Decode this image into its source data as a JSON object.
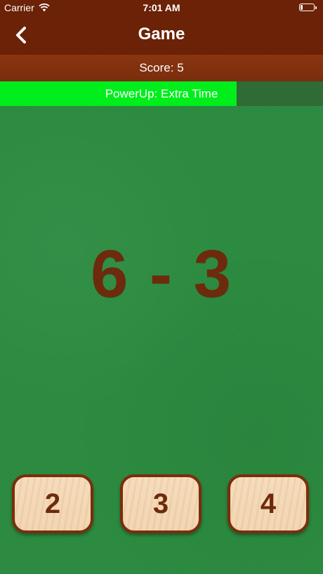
{
  "status": {
    "carrier": "Carrier",
    "time": "7:01 AM",
    "battery_fraction": 0.15
  },
  "nav": {
    "title": "Game",
    "back_icon": "chevron-left-icon"
  },
  "score": {
    "label": "Score: 5"
  },
  "powerup": {
    "label": "PowerUp: Extra Time",
    "progress_fraction": 0.733,
    "fill_color": "#00ee1c",
    "track_color": "#2f6b35"
  },
  "question": {
    "equation": "6 - 3"
  },
  "answers": [
    {
      "label": "2"
    },
    {
      "label": "3"
    },
    {
      "label": "4"
    }
  ],
  "colors": {
    "header_brown": "#6b2206",
    "felt_green": "#2b8b3f",
    "text_brown": "#6e2a0c",
    "tile_face": "#f6dcbc"
  }
}
